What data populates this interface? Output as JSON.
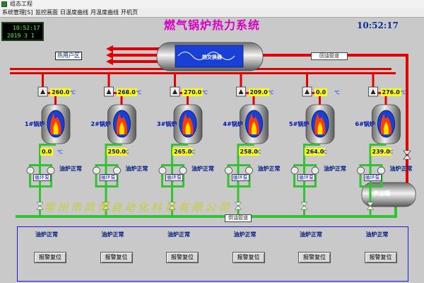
{
  "window": {
    "title": "组态工程"
  },
  "menu": [
    {
      "label": "系统管理[S]"
    },
    {
      "label": "监控画面"
    },
    {
      "label": "日温度曲线"
    },
    {
      "label": "月温度曲线"
    },
    {
      "label": "开机页"
    }
  ],
  "clock": {
    "time": "10:52:17",
    "date": "2019  3   1"
  },
  "title": "燃气锅炉热力系统",
  "big_clock": "10:52:17",
  "labels": {
    "heat_user": "热用户区",
    "heat_exchanger": "热交换器",
    "return_pipe": "回油管道",
    "supply_pipe": "供油管道",
    "supply_tank": "供油罐",
    "watermark": "常州市凯博自动化科技有限公司"
  },
  "boilers": [
    {
      "name": "1#锅炉",
      "pump_value": "260.0",
      "oil_value": "0.0",
      "status": "油炉正常",
      "pump_label": "循环泵"
    },
    {
      "name": "2#锅炉",
      "pump_value": "268.0",
      "oil_value": "250.0",
      "status": "油炉正常",
      "pump_label": "循环泵"
    },
    {
      "name": "3#锅炉",
      "pump_value": "270.0",
      "oil_value": "265.0",
      "status": "油炉正常",
      "pump_label": "循环泵"
    },
    {
      "name": "4#锅炉",
      "pump_value": "209.0",
      "oil_value": "258.0",
      "status": "油炉正常",
      "pump_label": "循环泵"
    },
    {
      "name": "5#锅炉",
      "pump_value": "0.0",
      "oil_value": "264.0",
      "status": "油炉正常",
      "pump_label": "循环泵"
    },
    {
      "name": "6#锅炉",
      "pump_value": "276.0",
      "oil_value": "239.0",
      "status": "油炉正常",
      "pump_label": "循环泵"
    }
  ],
  "unit": "℃",
  "bottom_panel": [
    {
      "status": "油炉正常",
      "button": "报警复位"
    },
    {
      "status": "油炉正常",
      "button": "报警复位"
    },
    {
      "status": "油炉正常",
      "button": "报警复位"
    },
    {
      "status": "油炉正常",
      "button": "报警复位"
    },
    {
      "status": "油炉正常",
      "button": "报警复位"
    },
    {
      "status": "油炉正常",
      "button": "报警复位"
    }
  ],
  "colors": {
    "hot_pipe": "#e30000",
    "supply_pipe": "#34c234",
    "return_pipe": "#e30000",
    "title": "#d800c6",
    "value_bg": "#ffff00",
    "vessel": "#8a8a8a",
    "exchanger": "#1a3fd6"
  }
}
